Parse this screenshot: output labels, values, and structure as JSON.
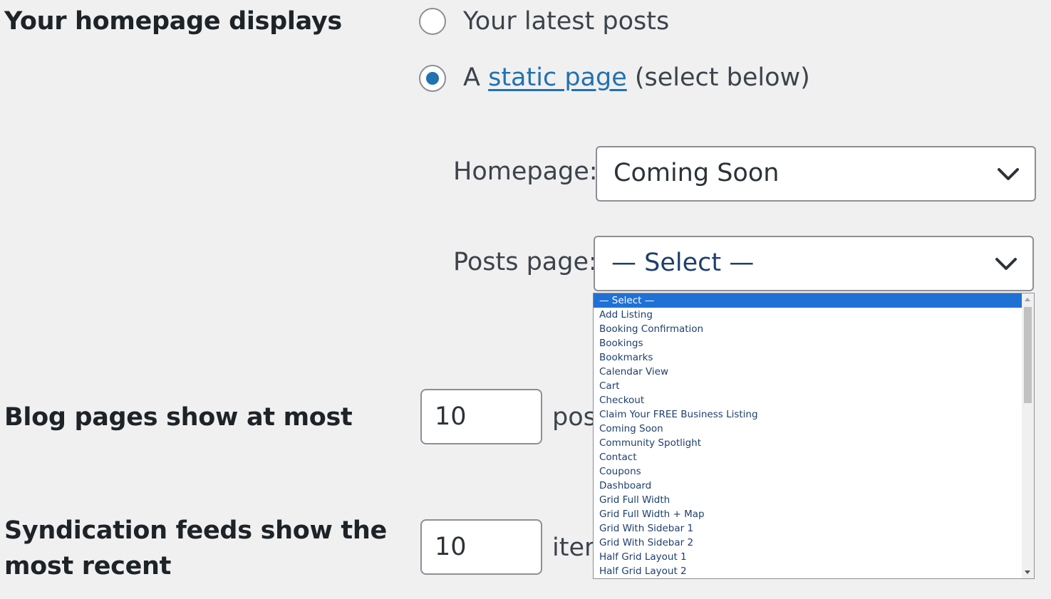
{
  "homepage_displays": {
    "label": "Your homepage displays",
    "option_latest": "Your latest posts",
    "option_static_prefix": "A",
    "option_static_link": "static page",
    "option_static_suffix": "(select below)",
    "selected": "static page"
  },
  "homepage_select": {
    "label": "Homepage:",
    "value": "Coming Soon"
  },
  "posts_page_select": {
    "label": "Posts page:",
    "value": "— Select —",
    "options": [
      "— Select —",
      "Add Listing",
      "Booking Confirmation",
      "Bookings",
      "Bookmarks",
      "Calendar View",
      "Cart",
      "Checkout",
      "Claim Your FREE Business Listing",
      "Coming Soon",
      "Community Spotlight",
      "Contact",
      "Coupons",
      "Dashboard",
      "Grid Full Width",
      "Grid Full Width + Map",
      "Grid With Sidebar 1",
      "Grid With Sidebar 2",
      "Half Grid Layout 1",
      "Half Grid Layout 2"
    ]
  },
  "blog_pages": {
    "label": "Blog pages show at most",
    "value": "10",
    "suffix": "pos"
  },
  "syndication": {
    "label_line1": "Syndication feeds show the",
    "label_line2": "most recent",
    "value": "10",
    "suffix": "iten"
  },
  "colors": {
    "accent": "#2271b1",
    "selected_option_bg": "#2071d6",
    "page_bg": "#f0f0f1"
  }
}
